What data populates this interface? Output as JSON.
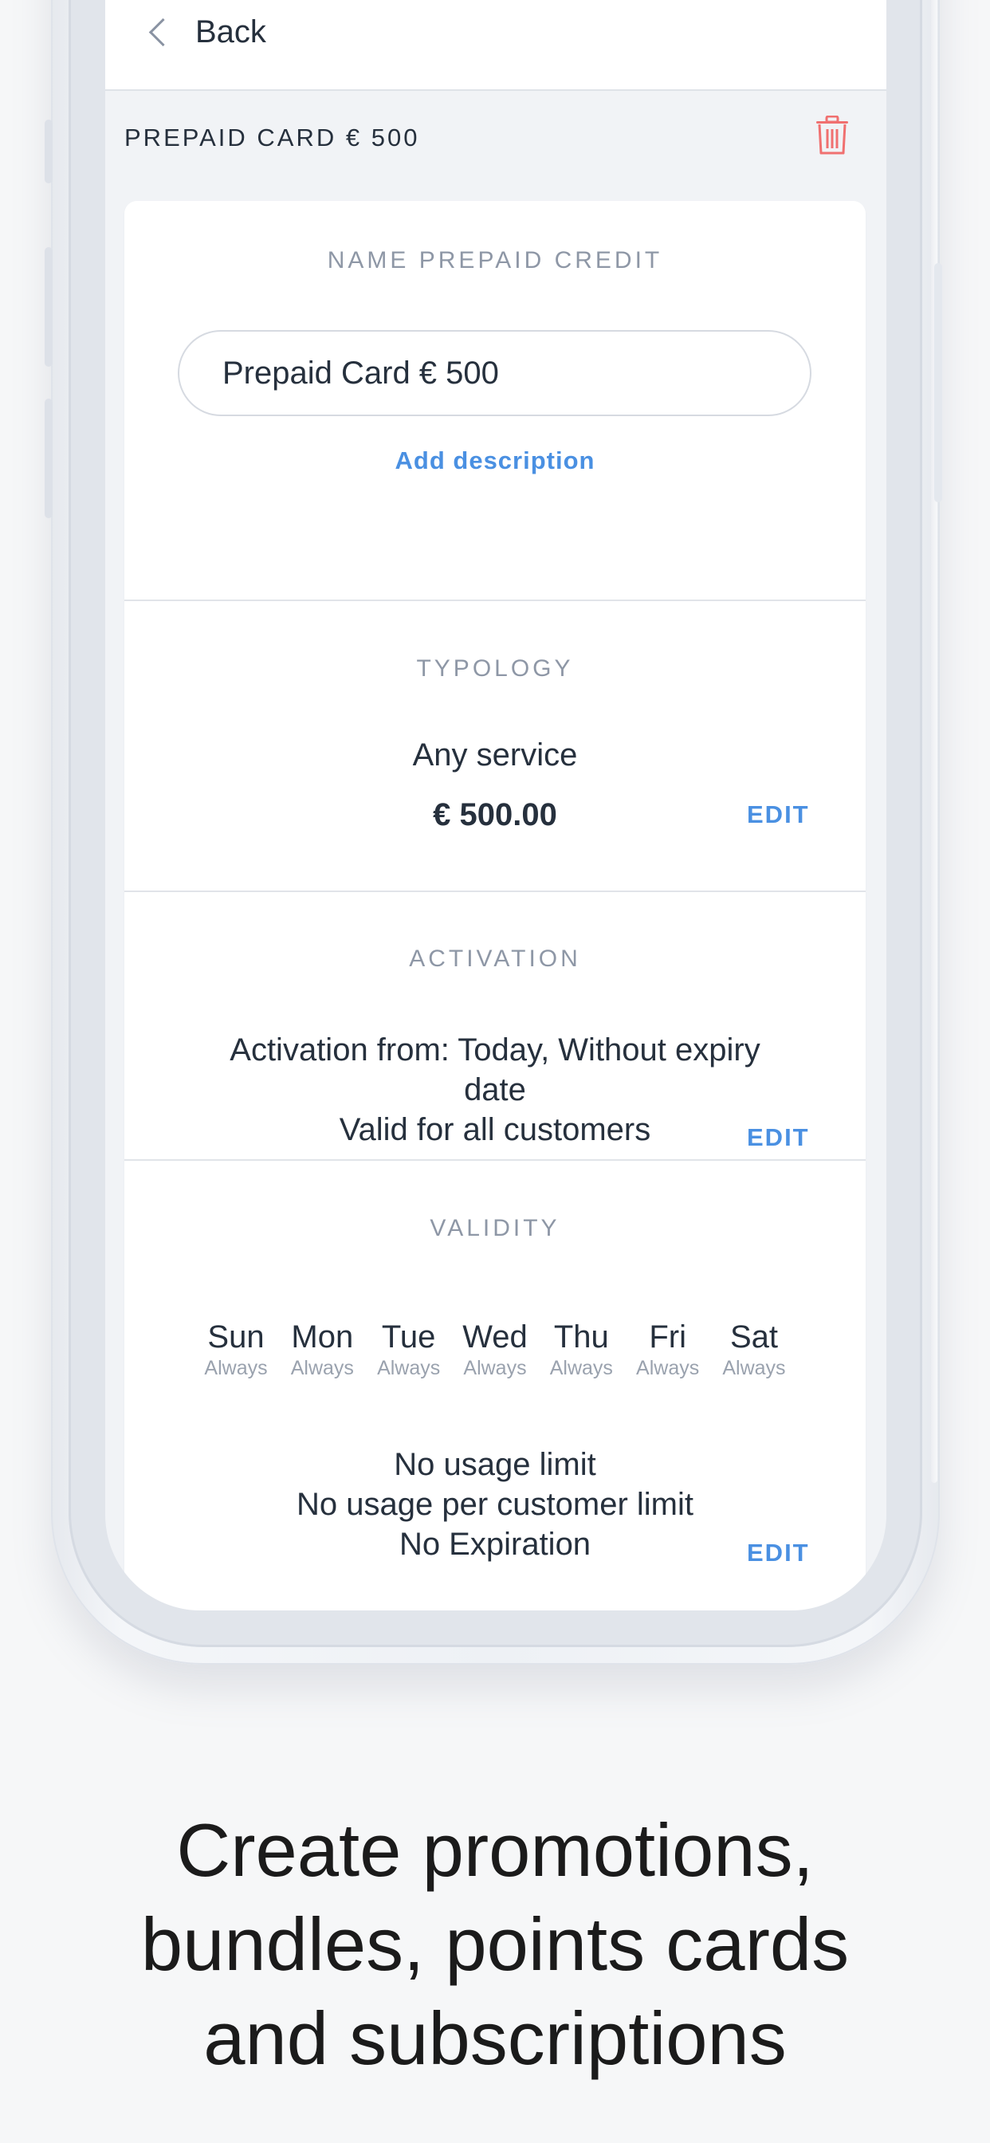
{
  "navbar": {
    "back_label": "Back"
  },
  "header": {
    "title": "PREPAID CARD € 500",
    "delete_icon": "trash-icon"
  },
  "name_section": {
    "label": "NAME PREPAID CREDIT",
    "value": "Prepaid Card € 500",
    "add_description": "Add description"
  },
  "typology": {
    "label": "TYPOLOGY",
    "service": "Any service",
    "amount": "€ 500.00",
    "edit": "EDIT"
  },
  "activation": {
    "label": "ACTIVATION",
    "line1": "Activation from: Today, Without expiry",
    "line2": "date",
    "line3": "Valid for all customers",
    "edit": "EDIT"
  },
  "validity": {
    "label": "VALIDITY",
    "days": [
      {
        "name": "Sun",
        "sub": "Always"
      },
      {
        "name": "Mon",
        "sub": "Always"
      },
      {
        "name": "Tue",
        "sub": "Always"
      },
      {
        "name": "Wed",
        "sub": "Always"
      },
      {
        "name": "Thu",
        "sub": "Always"
      },
      {
        "name": "Fri",
        "sub": "Always"
      },
      {
        "name": "Sat",
        "sub": "Always"
      }
    ],
    "limit1": "No usage limit",
    "limit2": "No usage per customer limit",
    "limit3": "No Expiration",
    "edit": "EDIT"
  },
  "tagline": {
    "line1": "Create promotions,",
    "line2": "bundles, points cards",
    "line3": "and subscriptions"
  },
  "colors": {
    "accent": "#4a90e2",
    "delete": "#f07070",
    "text": "#26303d",
    "muted": "#8e97a6"
  }
}
